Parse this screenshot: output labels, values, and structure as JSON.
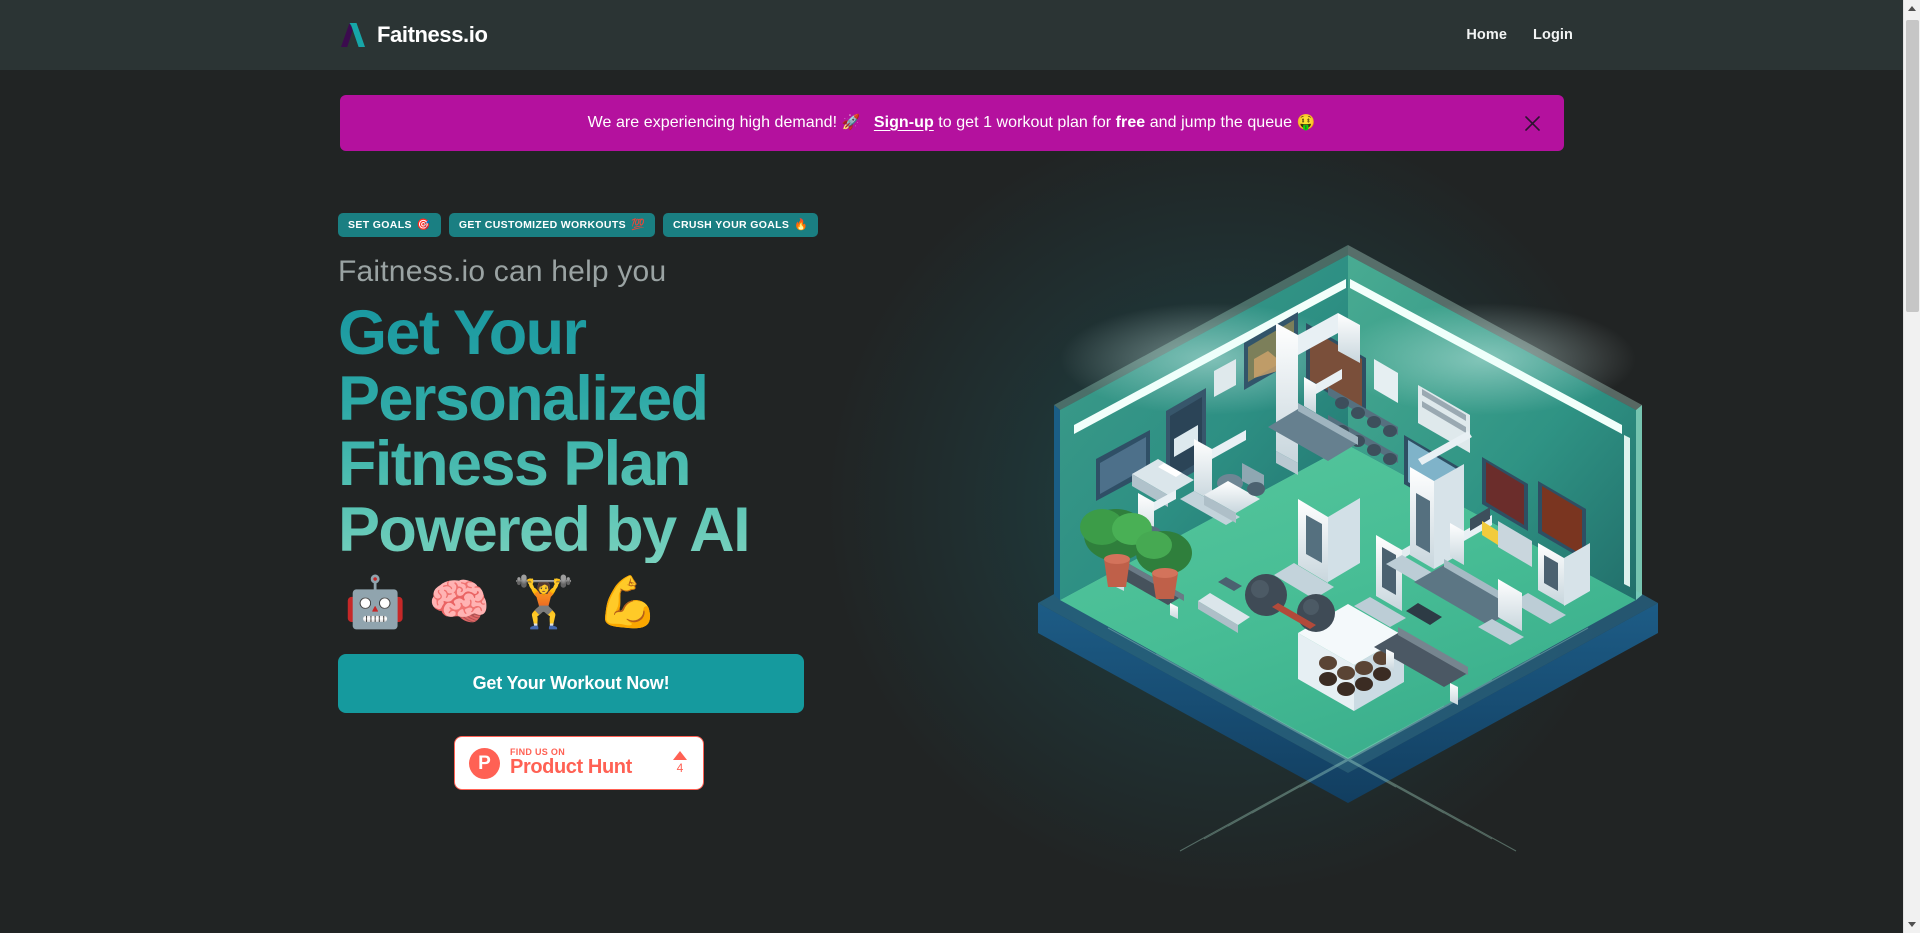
{
  "colors": {
    "page_bg": "#212424",
    "header_bg": "#2b3434",
    "accent_teal": "#159a9e",
    "badge_teal": "#1a7f82",
    "banner_magenta": "#b4119e",
    "product_hunt_red": "#ff6154",
    "headline_gradient_start": "#1897a0",
    "headline_gradient_end": "#7ed3bf",
    "eyebrow_gray": "#9aa3a3"
  },
  "header": {
    "brand_name": "Faitness.io",
    "logo_icon": "a-mark-logo-icon",
    "nav": [
      {
        "label": "Home",
        "name": "nav-link-home"
      },
      {
        "label": "Login",
        "name": "nav-link-login"
      }
    ]
  },
  "banner": {
    "text_before_link": "We are experiencing high demand!",
    "rocket_emoji": "🚀",
    "link_label": "Sign-up",
    "text_after_link": " to get 1 workout plan for ",
    "bold_word": "free",
    "text_tail": " and jump the queue ",
    "tail_emoji": "🤑",
    "close_icon": "close-icon"
  },
  "hero": {
    "badges": [
      {
        "label": "SET GOALS",
        "emoji": "🎯"
      },
      {
        "label": "GET CUSTOMIZED WORKOUTS",
        "emoji": "💯"
      },
      {
        "label": "CRUSH YOUR GOALS",
        "emoji": "🔥"
      }
    ],
    "eyebrow": "Faitness.io can help you",
    "title_lines": [
      "Get Your",
      "Personalized",
      "Fitness Plan",
      "Powered by AI"
    ],
    "emojis": [
      {
        "glyph": "🤖",
        "name": "robot-emoji"
      },
      {
        "glyph": "🧠",
        "name": "brain-emoji"
      },
      {
        "glyph": "🏋️",
        "name": "weightlifter-emoji"
      },
      {
        "glyph": "💪",
        "name": "flexed-biceps-emoji"
      }
    ],
    "cta_label": "Get Your Workout Now!",
    "product_hunt": {
      "kicker": "FIND US ON",
      "name": "Product Hunt",
      "logo_letter": "P",
      "upvote_count": "4"
    },
    "illustration_alt": "isometric-3d-gym-room-illustration"
  },
  "scrollbar": {
    "up_arrow": "scroll-up-arrow-icon",
    "down_arrow": "scroll-down-arrow-icon"
  }
}
